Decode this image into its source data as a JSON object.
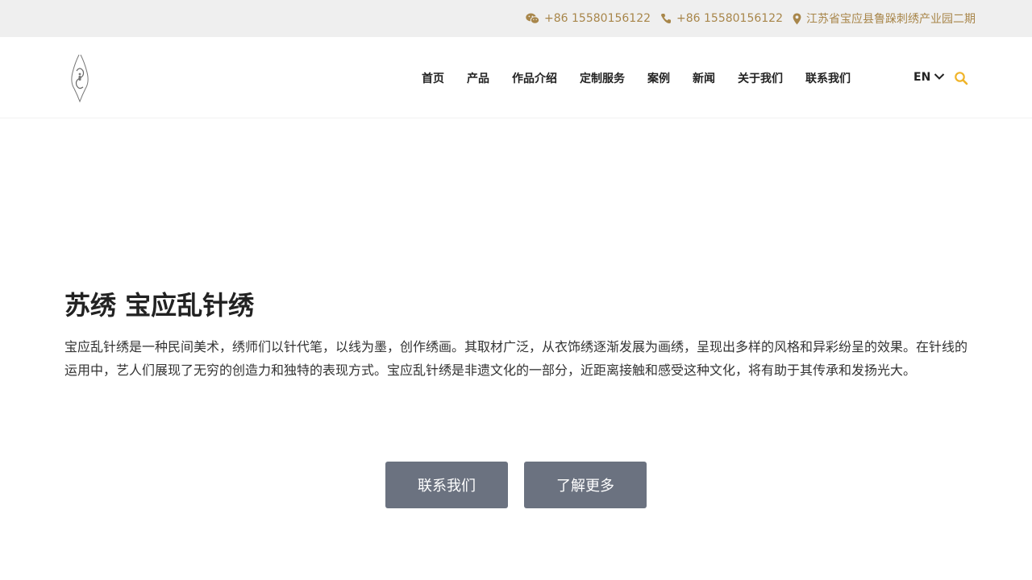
{
  "topbar": {
    "wechat": "+86 15580156122",
    "phone": "+86 15580156122",
    "address": "江苏省宝应县鲁跺刺绣产业园二期",
    "accent_color": "#a8864a"
  },
  "nav": {
    "items": [
      "首页",
      "产品",
      "作品介绍",
      "定制服务",
      "案例",
      "新闻",
      "关于我们",
      "联系我们"
    ],
    "lang": "EN"
  },
  "icons": {
    "wechat": "wechat-icon",
    "phone": "phone-icon",
    "location": "location-pin-icon",
    "chevron": "chevron-down-icon",
    "search": "search-icon",
    "search_color": "#f0b429"
  },
  "hero": {
    "title": "苏绣 宝应乱针绣",
    "description": "宝应乱针绣是一种民间美术，绣师们以针代笔，以线为墨，创作绣画。其取材广泛，从衣饰绣逐渐发展为画绣，呈现出多样的风格和异彩纷呈的效果。在针线的运用中，艺人们展现了无穷的创造力和独特的表现方式。宝应乱针绣是非遗文化的一部分，近距离接触和感受这种文化，将有助于其传承和发扬光大。"
  },
  "buttons": {
    "contact": "联系我们",
    "more": "了解更多",
    "color": "#6b7280"
  }
}
